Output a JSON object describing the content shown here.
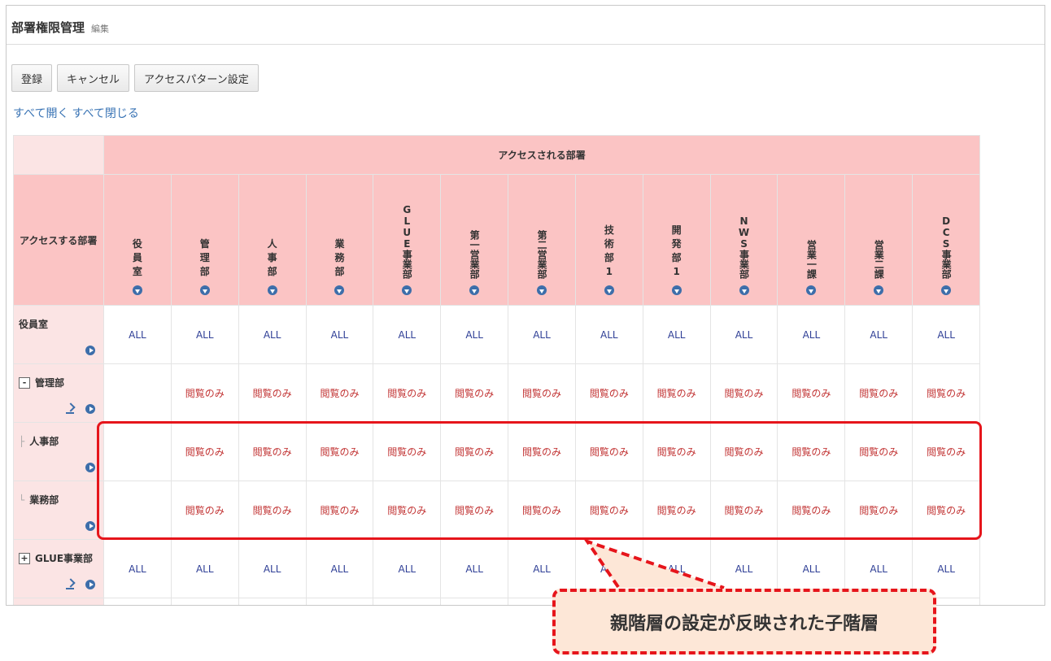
{
  "page": {
    "title": "部署権限管理",
    "subtitle": "編集"
  },
  "toolbar": {
    "register_label": "登録",
    "cancel_label": "キャンセル",
    "pattern_label": "アクセスパターン設定"
  },
  "links": {
    "expand_all": "すべて開く",
    "collapse_all": "すべて閉じる"
  },
  "matrix": {
    "accessed_header": "アクセスされる部署",
    "accessor_header": "アクセスする部署",
    "columns": [
      {
        "label": "役員室",
        "lines": [
          "役",
          "員",
          "室"
        ]
      },
      {
        "label": "管理部",
        "lines": [
          "管",
          "理",
          "部"
        ]
      },
      {
        "label": "人事部",
        "lines": [
          "人",
          "事",
          "部"
        ]
      },
      {
        "label": "業務部",
        "lines": [
          "業",
          "務",
          "部"
        ]
      },
      {
        "label": "GLUE事業部",
        "lines": [
          "GLUE事業部"
        ]
      },
      {
        "label": "第一営業部",
        "lines": [
          "第一営業部"
        ]
      },
      {
        "label": "第二営業部",
        "lines": [
          "第二営業部"
        ]
      },
      {
        "label": "技術部1",
        "lines": [
          "技",
          "術",
          "部",
          "1"
        ]
      },
      {
        "label": "開発部1",
        "lines": [
          "開",
          "発",
          "部",
          "1"
        ]
      },
      {
        "label": "NWS事業部",
        "lines": [
          "NWS事業部"
        ]
      },
      {
        "label": "営業一課",
        "lines": [
          "営業一課"
        ]
      },
      {
        "label": "営業二課",
        "lines": [
          "営業二課"
        ]
      },
      {
        "label": "DCS事業部",
        "lines": [
          "DCS事業部"
        ]
      }
    ],
    "rows": [
      {
        "label": "役員室",
        "tree": "",
        "copy_icon": false,
        "cells": [
          "ALL",
          "ALL",
          "ALL",
          "ALL",
          "ALL",
          "ALL",
          "ALL",
          "ALL",
          "ALL",
          "ALL",
          "ALL",
          "ALL",
          "ALL"
        ]
      },
      {
        "label": "管理部",
        "tree": "-",
        "copy_icon": true,
        "cells": [
          "",
          "閲覧のみ",
          "閲覧のみ",
          "閲覧のみ",
          "閲覧のみ",
          "閲覧のみ",
          "閲覧のみ",
          "閲覧のみ",
          "閲覧のみ",
          "閲覧のみ",
          "閲覧のみ",
          "閲覧のみ",
          "閲覧のみ"
        ]
      },
      {
        "label": "人事部",
        "tree": "├",
        "copy_icon": false,
        "cells": [
          "",
          "閲覧のみ",
          "閲覧のみ",
          "閲覧のみ",
          "閲覧のみ",
          "閲覧のみ",
          "閲覧のみ",
          "閲覧のみ",
          "閲覧のみ",
          "閲覧のみ",
          "閲覧のみ",
          "閲覧のみ",
          "閲覧のみ"
        ]
      },
      {
        "label": "業務部",
        "tree": "└",
        "copy_icon": false,
        "cells": [
          "",
          "閲覧のみ",
          "閲覧のみ",
          "閲覧のみ",
          "閲覧のみ",
          "閲覧のみ",
          "閲覧のみ",
          "閲覧のみ",
          "閲覧のみ",
          "閲覧のみ",
          "閲覧のみ",
          "閲覧のみ",
          "閲覧のみ"
        ]
      },
      {
        "label": "GLUE事業部",
        "tree": "+",
        "copy_icon": true,
        "cells": [
          "ALL",
          "ALL",
          "ALL",
          "ALL",
          "ALL",
          "ALL",
          "ALL",
          "ALL",
          "ALL",
          "ALL",
          "ALL",
          "ALL",
          "ALL"
        ]
      }
    ]
  },
  "callout": {
    "text": "親階層の設定が反映された子階層"
  },
  "colors": {
    "header_pink": "#fbc4c4",
    "row_pink": "#fbe4e4",
    "all_text": "#2f3f96",
    "readonly_text": "#c23434",
    "highlight_red": "#e6151b",
    "callout_bg": "#fde7d7",
    "icon_blue": "#3d6eaa"
  }
}
